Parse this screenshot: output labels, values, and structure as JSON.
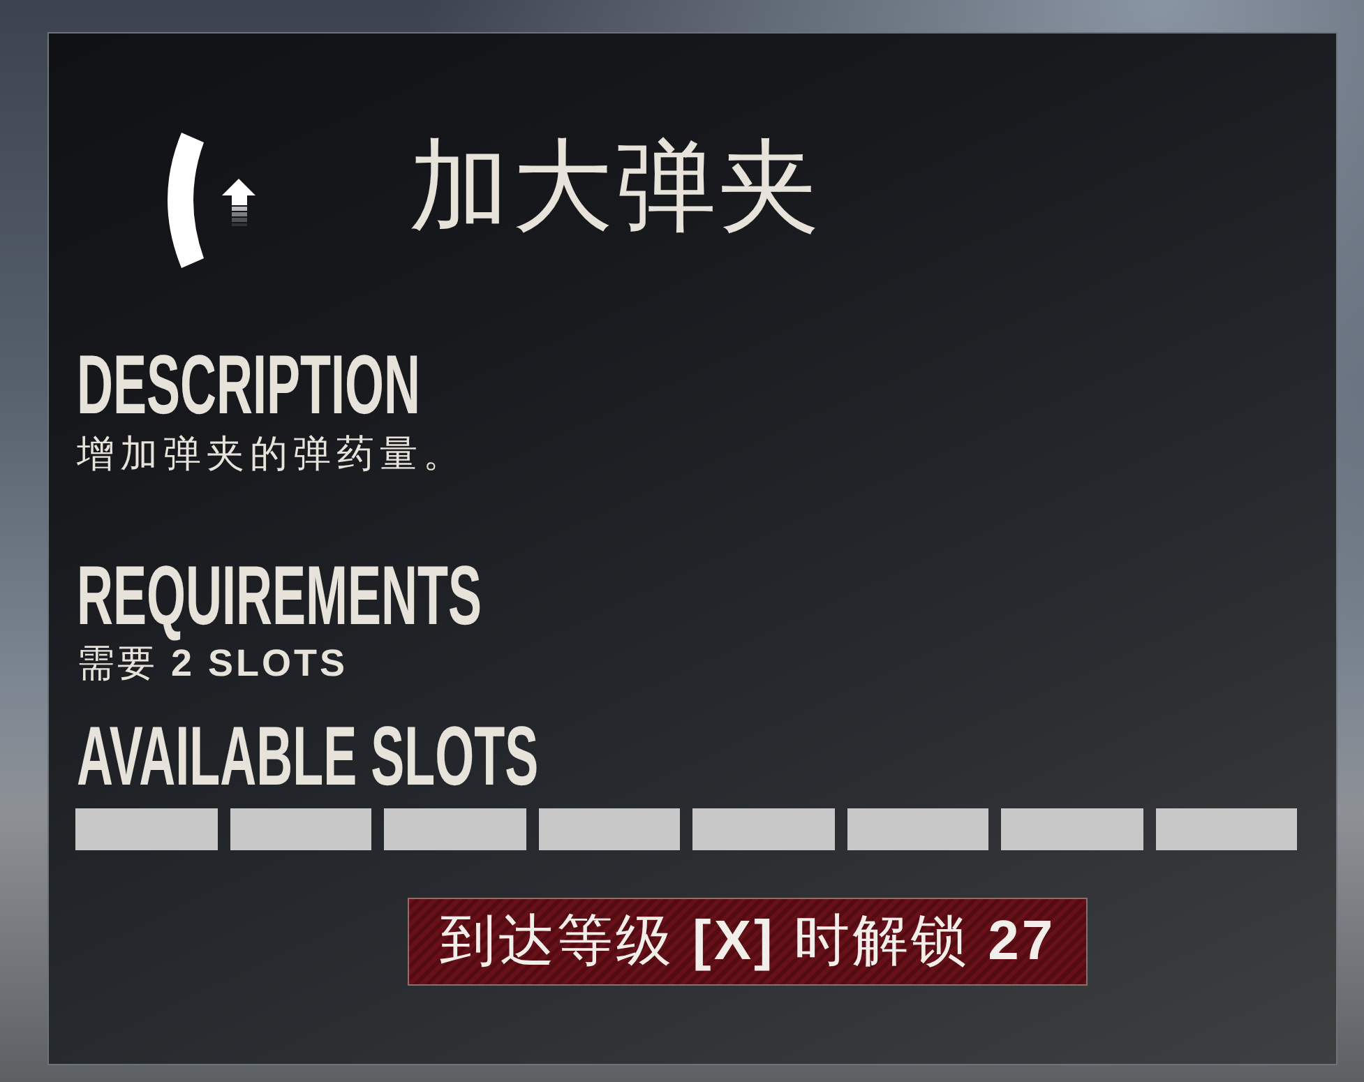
{
  "perk": {
    "title": "加大弹夹"
  },
  "description": {
    "heading": "DESCRIPTION",
    "text": "增加弹夹的弹药量。"
  },
  "requirements": {
    "heading": "REQUIREMENTS",
    "text": "需要 **2 SLOTS**"
  },
  "available_slots": {
    "heading": "AVAILABLE SLOTS",
    "slots": [
      {
        "filled": true
      },
      {
        "filled": true
      },
      {
        "filled": true
      },
      {
        "filled": true
      },
      {
        "filled": true
      },
      {
        "filled": true
      },
      {
        "filled": true
      },
      {
        "filled": true
      }
    ]
  },
  "unlock_notice": {
    "text": "到达等级 **[X]** 时解锁 **27**"
  }
}
